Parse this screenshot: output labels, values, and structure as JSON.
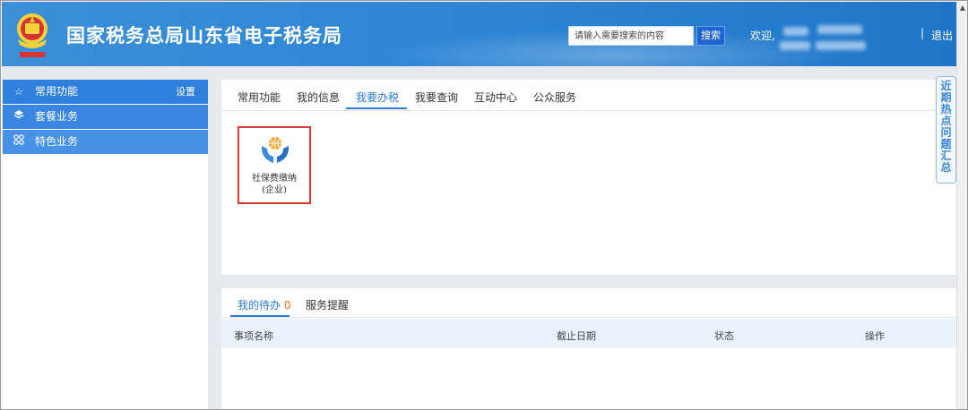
{
  "header": {
    "site_title": "国家税务总局山东省电子税务局",
    "search_placeholder": "请输入需要搜索的内容",
    "search_button": "搜索",
    "welcome": "欢迎,",
    "divider": "|",
    "logout": "退出"
  },
  "sidebar": {
    "items": [
      {
        "label": "常用功能",
        "icon": "star-icon",
        "extra": "设置"
      },
      {
        "label": "套餐业务",
        "icon": "layers-icon"
      },
      {
        "label": "特色业务",
        "icon": "grid-icon"
      }
    ]
  },
  "main": {
    "tabs": [
      "常用功能",
      "我的信息",
      "我要办税",
      "我要查询",
      "互动中心",
      "公众服务"
    ],
    "active_tab": "我要办税",
    "service": {
      "line1": "社保费缴纳",
      "line2": "(企业)",
      "icon": "hands-globe-icon"
    }
  },
  "todo": {
    "tab_label": "我的待办",
    "count": "0",
    "tab_reminder": "服务提醒",
    "columns": [
      "事项名称",
      "截止日期",
      "状态",
      "操作"
    ]
  },
  "float": {
    "hot_label": "近期热点问题汇总"
  },
  "colors": {
    "header_blue": "#2f86d6",
    "accent": "#2a7bd6",
    "highlight_red": "#d63a3a"
  }
}
